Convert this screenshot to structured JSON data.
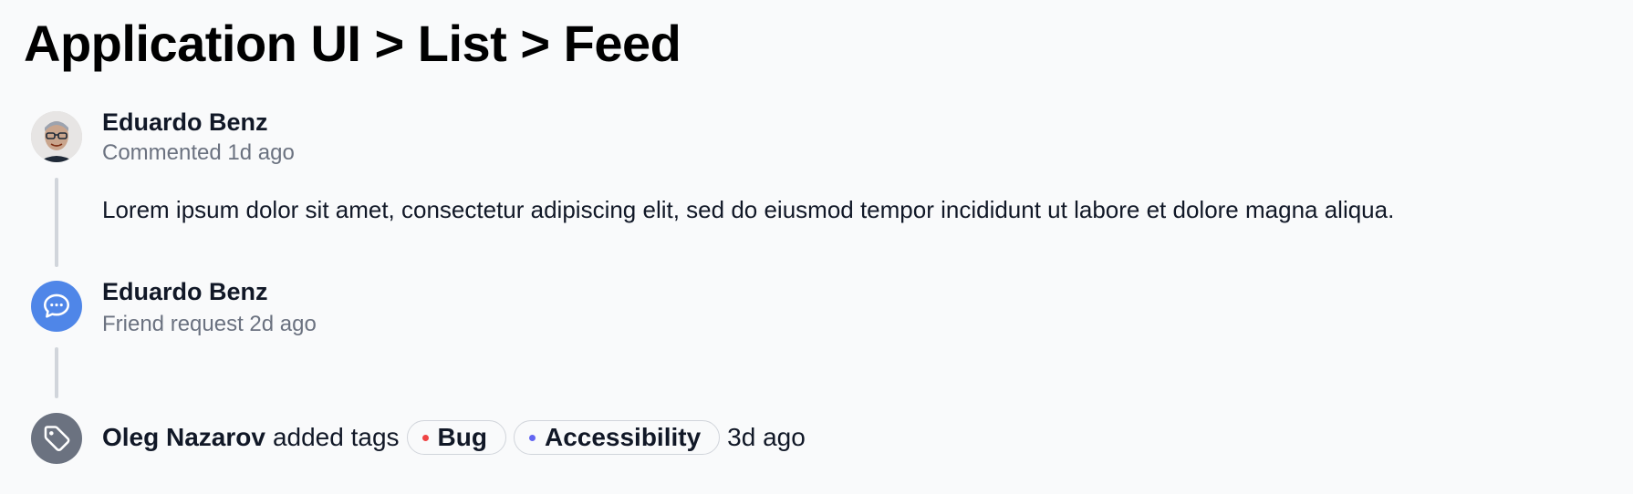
{
  "page": {
    "title": "Application UI > List > Feed"
  },
  "feed": {
    "items": [
      {
        "type": "comment",
        "author": "Eduardo Benz",
        "meta": "Commented 1d ago",
        "body": "Lorem ipsum dolor sit amet, consectetur adipiscing elit, sed do eiusmod tempor incididunt ut labore et dolore magna aliqua.",
        "avatar": "user-photo"
      },
      {
        "type": "friend-request",
        "author": "Eduardo Benz",
        "meta": "Friend request 2d ago",
        "icon": "chat-bubble-icon",
        "icon_bg": "#4f86e8"
      },
      {
        "type": "tags",
        "actor": "Oleg Nazarov",
        "action": "added tags",
        "tags": [
          {
            "label": "Bug",
            "dot_color": "#ef4444"
          },
          {
            "label": "Accessibility",
            "dot_color": "#6366f1"
          }
        ],
        "time": "3d ago",
        "icon": "tag-icon",
        "icon_bg": "#6b7280"
      }
    ]
  }
}
